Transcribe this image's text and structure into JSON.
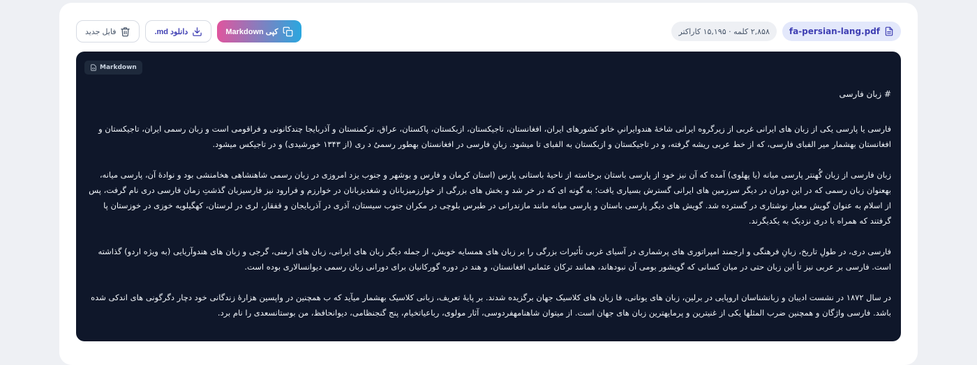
{
  "toolbar": {
    "file_name": "fa-persian-lang.pdf",
    "stats": "۲,۸۵۸ کلمه · ۱۵,۱۹۵ کاراکتر",
    "copy_label": "کپی Markdown",
    "download_label": "دانلود md.",
    "new_file_label": "فایل جدید"
  },
  "editor": {
    "badge": "Markdown",
    "heading": "# زبان فارسی",
    "paragraphs": [
      "فارسی یا پارسی یکی از زبان های ایرانی غربی از زیرگروه ایرانی شاخهٔ هندوایرانیِ خانو کشورهای ایران، افغانستان، تاجیکستان، ازبکستان، پاکستان، عراق، ترکمنستان و آذربایجا چندکانونی و فراقومی است و زبان رسمی ایران، تاجیکستان و افغانستان بهشمار میر الفبای فارسی، که از خط عربی ریشه گرفته، و در تاجیکستان و ازبکستان به الفبای تا میشود. زبانِ فارسی در افغانستان بهطور رسمیُ د ری (از ۱۳۴۳ خورشیدی) و در تاجیکس میشود.",
      "زبان فارسی از زبان گُهنتر پارسی میانه (یا پهلوی) آمده که آن نیز خود از پارسی باستان برخاسته از ناحیهٔ باستانی پارس (استان کرمان و فارس و بوشهر و جنوب یزد امروزی در زبان رسمی شاهنشاهی هخامنشی بود و نوادهٔ آن، پارسی میانه، بهعنوان زبان رسمی که در این دوران در دیگر سرزمین های ایرانی گسترش بسیاری یافت؛ به گونه ای که در خر شد و بخش های بزرگی از خوارزمیزبانان و شغدیزبانان در خوارزم و فرارود نیز فارسیزبان گذشتِ زمان فارسی دری نام گرفت، پس از اسلام به عنوان گویش معیار نوشتاری در گسترده شد. گویش های دیگر پارسی باستان و پارسی میانه مانند مازندرانی در طبرس بلوچی در مکران جنوب سیستان، آذری در آذربایجان و قفقاز، لری در لرستان، کهگیلویه خوزی در خوزستان پا گرفتند که همراه با دری نزدیک به یکدیگرند.",
      "فارسی دری، در طولِ تاریخ، زبانِ فرهنگی و ارجمند امپراتوری های پرشماری در آسیای غربی تأثیرات بزرگی را بر زبان های همسایه خویش، از جمله دیگر زبان های ایرانی، زبان های ارمنی، گرجی و زبان های هندوآریایی (به ویژه اردو) گذاشته است. فارسی بر عربی نیز تأ این زبان حتی در میان کسانی که گویشور بومی آن نبودهاند، همانند ترکان عثمانی افغانستان، و هند در دوره گورکانیان برای دورانی زبان رسمی دیوانسالاری بوده است.",
      "در سال ۱۸۷۲ در نشست ادیبان و زبانشناسان اروپایی در برلین، زبان های یونانی، فا زبان های کلاسیک جهان برگزیده شدند. بر پایهٔ تعریف، زبانی کلاسیک بهشمار میآید که ب همچنین در واپسین هزارهٔ زندگانی خود دچار دگرگونی های اندکی شده باشد. فارسی واژگان و همچنین ضرب المثلها یکی از غنیترین و پرمایهترین زبان های جهان است. از میتوان شاهنامهفردوسی، آثار مولوی، رباعیاتخیام، پنج گنجنظامی، دیوانحافظ، من بوستانسعدی را نام برد."
    ]
  },
  "icons": {
    "file": "file-text-icon",
    "copy": "copy-icon",
    "download": "download-icon",
    "trash": "trash-icon",
    "markdown_badge": "file-code-icon"
  },
  "colors": {
    "accent_pink": "#e0559e",
    "accent_blue": "#2aa7df",
    "editor_bg": "#0f172a",
    "file_pill_bg": "#e3e8fb"
  }
}
